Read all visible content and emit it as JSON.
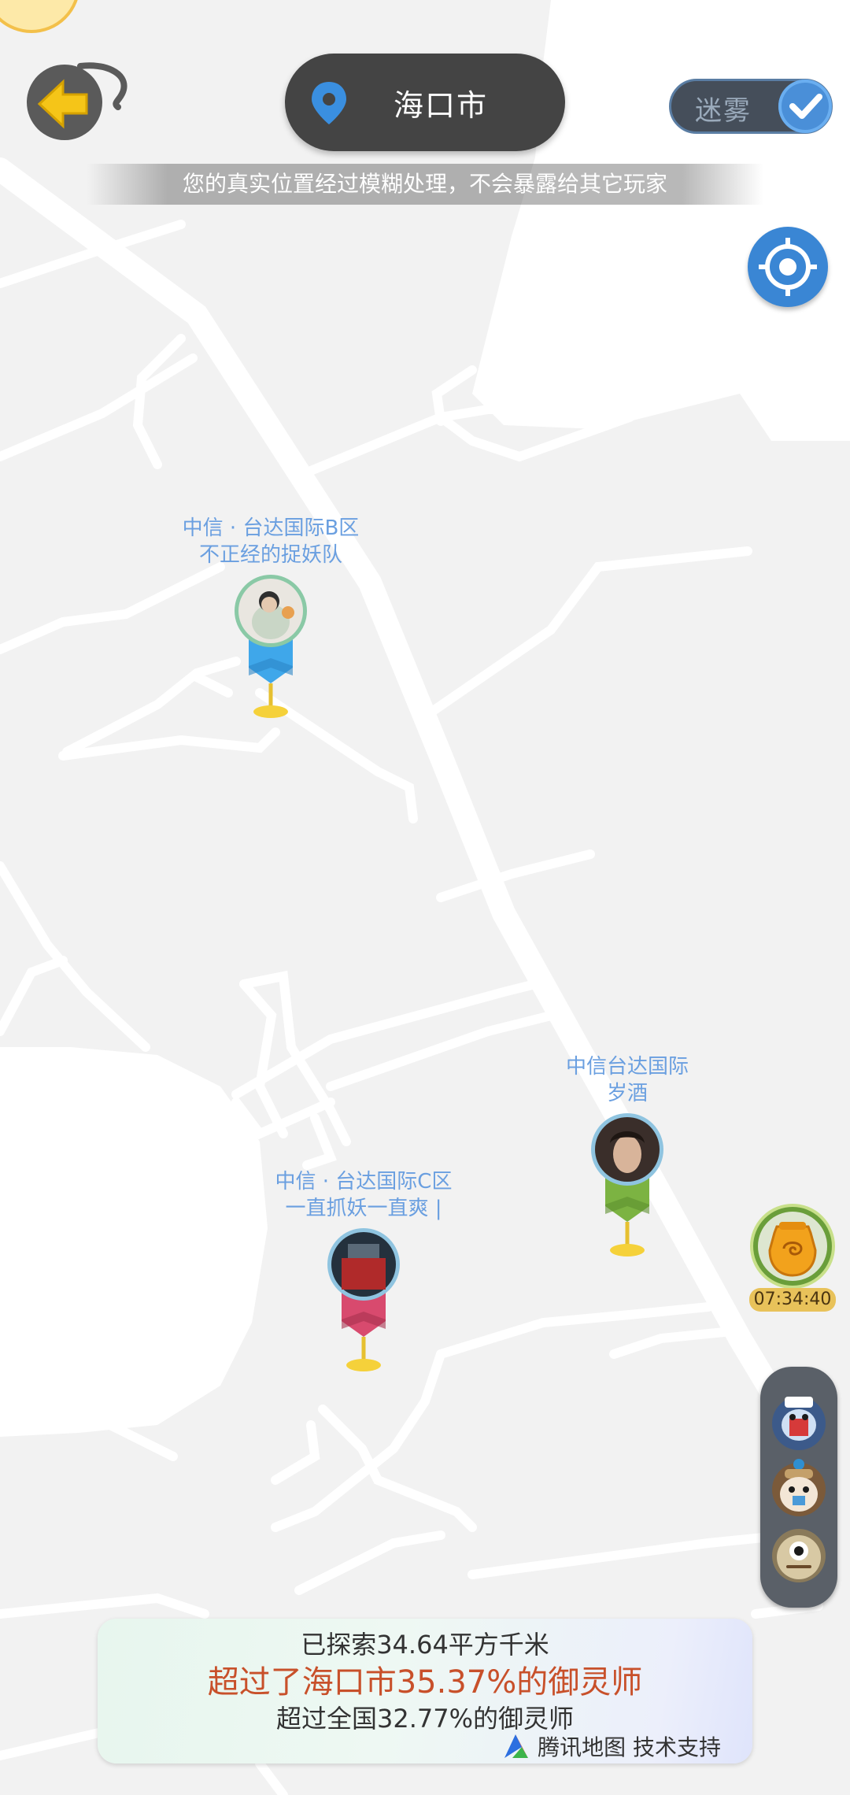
{
  "header": {
    "city": "海口市",
    "fog_label": "迷雾",
    "notice": "您的真实位置经过模糊处理，不会暴露给其它玩家"
  },
  "markers": [
    {
      "line1": "中信 · 台达国际B区",
      "line2": "不正经的捉妖队",
      "color": "#3fa7ea"
    },
    {
      "line1": "中信台达国际",
      "line2": "岁酒",
      "color": "#7cb342"
    },
    {
      "line1": "中信 · 台达国际C区",
      "line2": "一直抓妖一直爽 |",
      "color": "#d84a6e"
    }
  ],
  "timer": {
    "label": "07:34:40"
  },
  "stats": {
    "explored": "已探索34.64平方千米",
    "city_rank": "超过了海口市35.37%的御灵师",
    "national_rank": "超过全国32.77%的御灵师",
    "credit": "腾讯地图 技术支持"
  },
  "colors": {
    "accent_blue": "#3a86d4",
    "back_yellow": "#f5c518",
    "city_rank_orange": "#c8502a"
  }
}
